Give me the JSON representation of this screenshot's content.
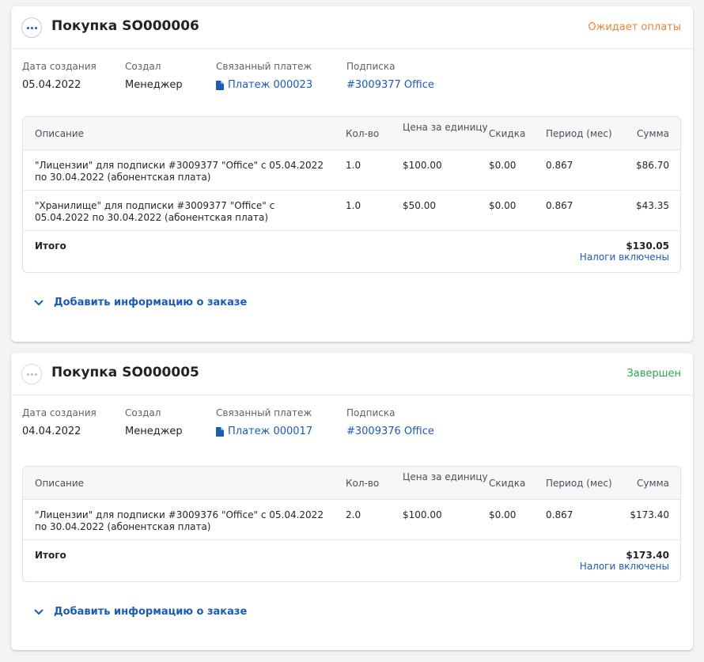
{
  "labels": {
    "created_date": "Дата создания",
    "created_by": "Создал",
    "linked_payment": "Связанный платеж",
    "subscription": "Подписка",
    "add_info": "Добавить информацию о заказе"
  },
  "table_headers": {
    "description": "Описание",
    "quantity": "Кол-во",
    "unit_price": "Цена за единицу",
    "discount": "Скидка",
    "period": "Период (мес)",
    "sum": "Сумма"
  },
  "icons": {
    "menu": "more-horizontal-icon",
    "payment": "document-icon",
    "expand": "chevron-down-icon"
  },
  "colors": {
    "accent": "#1b5bb8",
    "status_pending": "#e8833a",
    "status_done": "#2ea44f"
  },
  "orders": [
    {
      "title": "Покупка SO000006",
      "status": "Ожидает оплаты",
      "created_date": "05.04.2022",
      "created_by": "Менеджер",
      "payment": "Платеж 000023",
      "subscription": "#3009377 Office",
      "items": [
        {
          "description": "\"Лицензии\" для подписки #3009377 \"Office\" с 05.04.2022 по 30.04.2022 (абонентская плата)",
          "quantity": "1.0",
          "unit_price": "$100.00",
          "discount": "$0.00",
          "period": "0.867",
          "sum": "$86.70"
        },
        {
          "description": "\"Хранилище\" для подписки #3009377 \"Office\" с 05.04.2022 по 30.04.2022 (абонентская плата)",
          "quantity": "1.0",
          "unit_price": "$50.00",
          "discount": "$0.00",
          "period": "0.867",
          "sum": "$43.35"
        }
      ],
      "total_label": "Итого",
      "total": "$130.05",
      "tax_note": "Налоги включены"
    },
    {
      "title": "Покупка SO000005",
      "status": "Завершен",
      "created_date": "04.04.2022",
      "created_by": "Менеджер",
      "payment": "Платеж 000017",
      "subscription": "#3009376 Office",
      "items": [
        {
          "description": "\"Лицензии\" для подписки #3009376 \"Office\" с 05.04.2022 по 30.04.2022 (абонентская плата)",
          "quantity": "2.0",
          "unit_price": "$100.00",
          "discount": "$0.00",
          "period": "0.867",
          "sum": "$173.40"
        }
      ],
      "total_label": "Итого",
      "total": "$173.40",
      "tax_note": "Налоги включены"
    }
  ]
}
